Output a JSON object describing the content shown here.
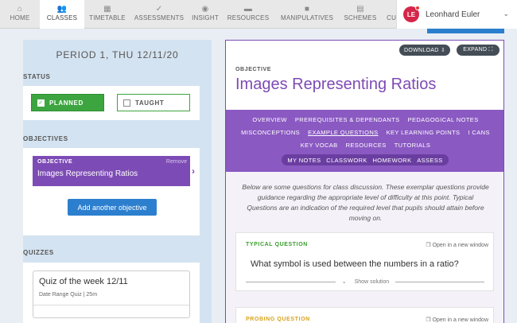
{
  "nav": {
    "items": [
      {
        "label": "HOME",
        "icon": "home-icon",
        "glyph": "⌂"
      },
      {
        "label": "CLASSES",
        "icon": "users-icon",
        "glyph": "👥"
      },
      {
        "label": "TIMETABLE",
        "icon": "calendar-icon",
        "glyph": "▦"
      },
      {
        "label": "ASSESSMENTS",
        "icon": "check-circle-icon",
        "glyph": "✓"
      },
      {
        "label": "INSIGHT",
        "icon": "eye-icon",
        "glyph": "◉"
      },
      {
        "label": "RESOURCES",
        "icon": "folder-icon",
        "glyph": "▬"
      },
      {
        "label": "MANIPULATIVES",
        "icon": "cube-icon",
        "glyph": "■"
      },
      {
        "label": "SCHEMES",
        "icon": "book-icon",
        "glyph": "▤"
      },
      {
        "label": "CURRICULUM",
        "icon": "globe-icon",
        "glyph": "◍"
      }
    ],
    "active": "CLASSES"
  },
  "user": {
    "initials": "LE",
    "name": "Leonhard Euler"
  },
  "lesson": {
    "period": "PERIOD 1, THU 12/11/20",
    "status_label": "STATUS",
    "planned_label": "PLANNED",
    "taught_label": "TAUGHT",
    "objectives_label": "OBJECTIVES",
    "objective_card_label": "OBJECTIVE",
    "objective_remove": "Remove",
    "objective_name": "Images Representing Ratios",
    "add_objective": "Add another objective",
    "quizzes_label": "QUIZZES",
    "quiz_title": "Quiz of the week 12/11",
    "quiz_subtitle": "Date Range Quiz  |  25m"
  },
  "detail": {
    "download": "DOWNLOAD ⇩",
    "expand": "EXPAND ⛶",
    "objective_label": "OBJECTIVE",
    "objective_title": "Images Representing Ratios",
    "tabs_row1": [
      "OVERVIEW",
      "PREREQUISITES & DEPENDANTS",
      "PEDAGOGICAL NOTES"
    ],
    "tabs_row2": [
      "MISCONCEPTIONS",
      "EXAMPLE QUESTIONS",
      "KEY LEARNING POINTS",
      "I CANS"
    ],
    "tabs_row3": [
      "KEY VOCAB",
      "RESOURCES",
      "TUTORIALS"
    ],
    "pills": [
      "MY NOTES",
      "CLASSWORK",
      "HOMEWORK",
      "ASSESS"
    ],
    "selected_tab": "EXAMPLE QUESTIONS",
    "intro": "Below are some questions for class discussion. These exemplar questions provide guidance regarding the appropriate level of difficulty at this point. Typical Questions are an indication of the required level that pupils should attain before moving on.",
    "typical_label": "TYPICAL QUESTION",
    "open_window": "Open in a new window",
    "typical_question": "What symbol is used between the numbers in a ratio?",
    "show_solution": "Show solution",
    "probing_label": "PROBING QUESTION"
  },
  "colors": {
    "accent_purple": "#7d4bb5",
    "planned_green": "#3da53f",
    "button_blue": "#2c7fce",
    "avatar_red": "#d4264a"
  }
}
